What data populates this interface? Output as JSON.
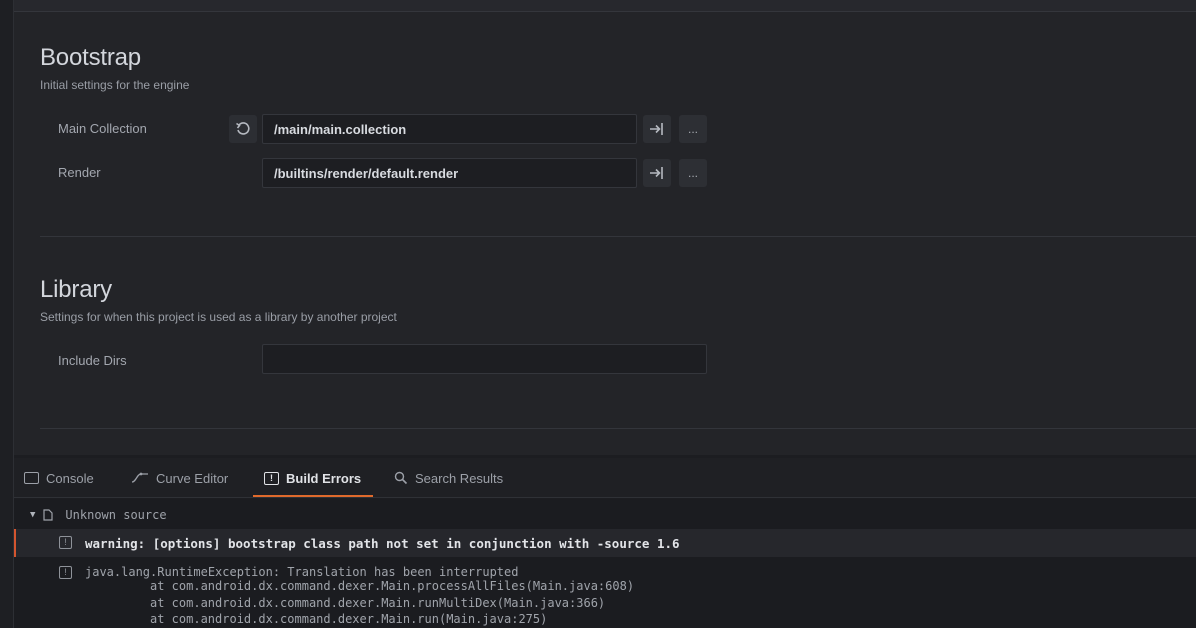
{
  "bootstrap": {
    "title": "Bootstrap",
    "subtitle": "Initial settings for the engine",
    "main_collection": {
      "label": "Main Collection",
      "value": "/main/main.collection",
      "more": "..."
    },
    "render": {
      "label": "Render",
      "value": "/builtins/render/default.render",
      "more": "..."
    }
  },
  "library": {
    "title": "Library",
    "subtitle": "Settings for when this project is used as a library by another project",
    "include_dirs": {
      "label": "Include Dirs",
      "value": ""
    }
  },
  "tabs": [
    {
      "label": "Console",
      "icon": "console-icon"
    },
    {
      "label": "Curve Editor",
      "icon": "curve-icon"
    },
    {
      "label": "Build Errors",
      "icon": "build-errors-icon",
      "active": true
    },
    {
      "label": "Search Results",
      "icon": "search-icon"
    }
  ],
  "build_errors": {
    "source": "Unknown source",
    "warning": "warning: [options] bootstrap class path not set in conjunction with -source 1.6",
    "error_title": "java.lang.RuntimeException: Translation has been interrupted",
    "stack": [
      "at com.android.dx.command.dexer.Main.processAllFiles(Main.java:608)",
      "at com.android.dx.command.dexer.Main.runMultiDex(Main.java:366)",
      "at com.android.dx.command.dexer.Main.run(Main.java:275)"
    ]
  },
  "colors": {
    "accent": "#e06a2c",
    "warning_bar": "#d4552f",
    "background": "#232428"
  }
}
